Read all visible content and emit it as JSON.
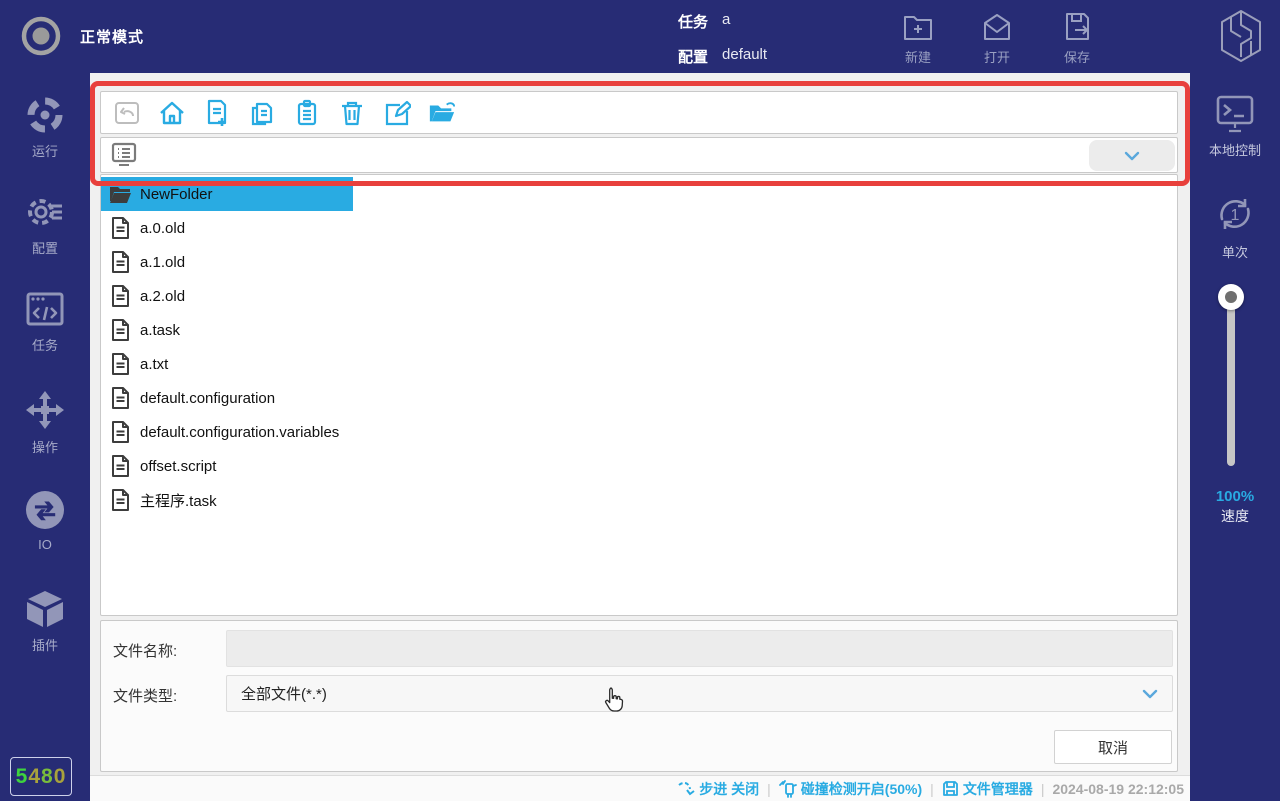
{
  "topbar": {
    "mode_label": "正常模式",
    "task_label": "任务",
    "task_value": "a",
    "config_label": "配置",
    "config_value": "default",
    "actions": {
      "new": "新建",
      "open": "打开",
      "save": "保存"
    }
  },
  "sidebar_left": {
    "items": [
      {
        "label": "运行",
        "icon": "run-icon"
      },
      {
        "label": "配置",
        "icon": "config-icon"
      },
      {
        "label": "任务",
        "icon": "task-icon"
      },
      {
        "label": "操作",
        "icon": "operate-icon"
      },
      {
        "label": "IO",
        "icon": "io-icon"
      },
      {
        "label": "插件",
        "icon": "plugin-icon"
      }
    ],
    "counter_digits": [
      {
        "ch": "5",
        "color": "#3ed33e"
      },
      {
        "ch": "4",
        "color": "#a9a23c"
      },
      {
        "ch": "8",
        "color": "#79bd3c"
      },
      {
        "ch": "0",
        "color": "#a9a23c"
      }
    ]
  },
  "sidebar_right": {
    "local_control_label": "本地控制",
    "single_label": "单次",
    "speed_percent": "100%",
    "speed_label": "速度",
    "accent_color": "#29abe2"
  },
  "file_manager": {
    "toolbar_icons": [
      "back-icon",
      "home-icon",
      "new-file-icon",
      "copy-icon",
      "paste-icon",
      "delete-icon",
      "rename-icon",
      "open-folder-icon"
    ],
    "path_value": "",
    "files": [
      {
        "name": "NewFolder",
        "type": "folder",
        "state": "selected"
      },
      {
        "name": "a.0.old",
        "type": "file",
        "state": ""
      },
      {
        "name": "a.1.old",
        "type": "file",
        "state": ""
      },
      {
        "name": "a.2.old",
        "type": "file",
        "state": ""
      },
      {
        "name": "a.task",
        "type": "file",
        "state": ""
      },
      {
        "name": "a.txt",
        "type": "file",
        "state": ""
      },
      {
        "name": "default.configuration",
        "type": "file",
        "state": ""
      },
      {
        "name": "default.configuration.variables",
        "type": "file",
        "state": ""
      },
      {
        "name": "offset.script",
        "type": "file",
        "state": ""
      },
      {
        "name": "主程序.task",
        "type": "file",
        "state": ""
      }
    ],
    "form": {
      "name_label": "文件名称:",
      "name_value": "",
      "type_label": "文件类型:",
      "type_value": "全部文件(*.*)",
      "cancel_label": "取消"
    },
    "selection_color": "#29abe2"
  },
  "statusbar": {
    "step_text": "步进 关闭",
    "collision_text": "碰撞检测开启(50%)",
    "tool_text": "文件管理器",
    "timestamp": "2024-08-19 22:12:05"
  }
}
